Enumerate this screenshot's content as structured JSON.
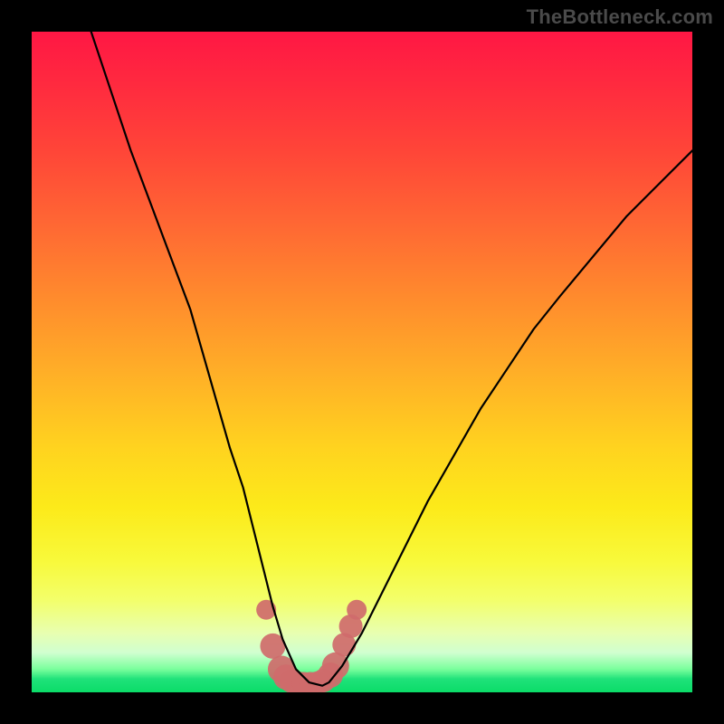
{
  "watermark": "TheBottleneck.com",
  "chart_data": {
    "type": "line",
    "title": "",
    "xlabel": "",
    "ylabel": "",
    "xlim": [
      0,
      100
    ],
    "ylim": [
      0,
      100
    ],
    "grid": false,
    "legend": {
      "visible": false
    },
    "series": [
      {
        "name": "bottleneck-curve",
        "stroke": "#000000",
        "x": [
          9,
          12,
          15,
          18,
          21,
          24,
          26,
          28,
          30,
          32,
          33.5,
          35,
          36.5,
          38,
          40,
          42,
          44,
          45,
          47,
          50,
          53,
          56,
          60,
          64,
          68,
          72,
          76,
          80,
          85,
          90,
          95,
          100
        ],
        "values": [
          100,
          91,
          82,
          74,
          66,
          58,
          51,
          44,
          37,
          31,
          25,
          19,
          13,
          8,
          3.5,
          1.5,
          1,
          1.5,
          4,
          9,
          15,
          21,
          29,
          36,
          43,
          49,
          55,
          60,
          66,
          72,
          77,
          82
        ]
      },
      {
        "name": "bottom-dot-band",
        "type": "scatter",
        "fill": "#cf6b6b",
        "x": [
          35.5,
          36.5,
          37.8,
          38.5,
          39.3,
          40.2,
          41.2,
          42.2,
          43.3,
          44.2,
          45.2,
          46.0,
          47.3,
          48.3,
          49.2
        ],
        "values": [
          12.5,
          7.0,
          3.5,
          2.3,
          1.7,
          1.4,
          1.3,
          1.3,
          1.4,
          1.8,
          2.6,
          4.0,
          7.2,
          10.0,
          12.5
        ],
        "radius": [
          11,
          14,
          15,
          14,
          13,
          13,
          13,
          13,
          13,
          13,
          14,
          15,
          13,
          13,
          11
        ]
      }
    ],
    "background_gradient": {
      "direction": "vertical",
      "stops": [
        {
          "pos": 0.0,
          "color": "#ff1744"
        },
        {
          "pos": 0.3,
          "color": "#ff6a33"
        },
        {
          "pos": 0.6,
          "color": "#ffd31f"
        },
        {
          "pos": 0.85,
          "color": "#f3ff6a"
        },
        {
          "pos": 1.0,
          "color": "#0bdc68"
        }
      ]
    }
  }
}
